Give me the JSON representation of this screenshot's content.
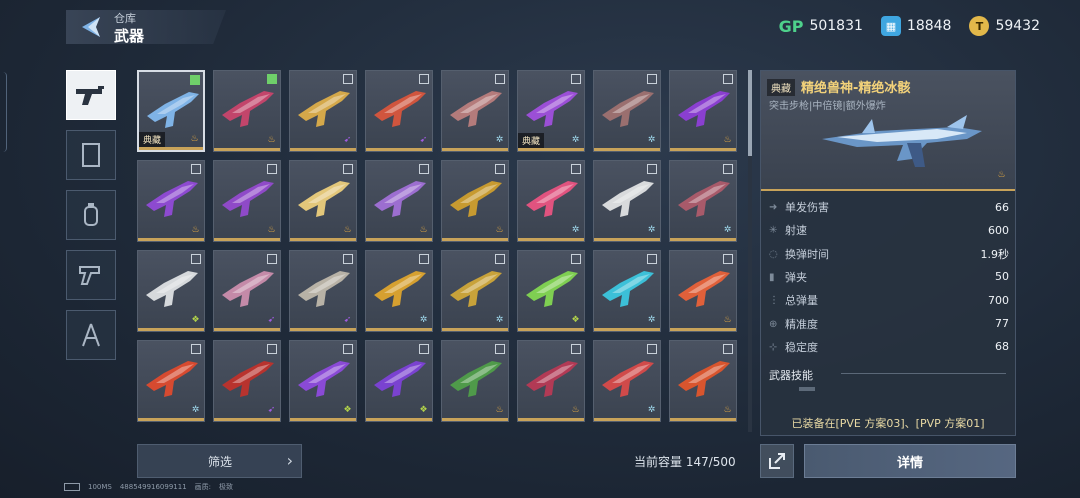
{
  "header": {
    "parent": "仓库",
    "title": "武器"
  },
  "currencies": [
    {
      "icon": "gp-icon",
      "symbol": "GP",
      "value": "501831"
    },
    {
      "icon": "ticket-icon",
      "symbol": "▦",
      "value": "18848"
    },
    {
      "icon": "coin-icon",
      "symbol": "T",
      "value": "59432"
    }
  ],
  "categories": [
    "weapon-category",
    "armor-category",
    "grenade-category",
    "melee-category",
    "tool-category"
  ],
  "items": [
    {
      "tag": "典藏",
      "badge": "fire",
      "checked": true,
      "color": "#7fb3e6"
    },
    {
      "tag": "",
      "badge": "fire",
      "checked": true,
      "color": "#c2456b"
    },
    {
      "tag": "",
      "badge": "arrow",
      "checked": false,
      "color": "#d4a84a"
    },
    {
      "tag": "",
      "badge": "arrow",
      "checked": false,
      "color": "#d0553e"
    },
    {
      "tag": "",
      "badge": "star",
      "checked": false,
      "color": "#b47b7b"
    },
    {
      "tag": "典藏",
      "badge": "star",
      "checked": false,
      "color": "#9b4fd6"
    },
    {
      "tag": "",
      "badge": "star",
      "checked": false,
      "color": "#9a6f6f"
    },
    {
      "tag": "",
      "badge": "fire",
      "checked": false,
      "color": "#8a3fd0"
    },
    {
      "tag": "",
      "badge": "fire",
      "checked": false,
      "color": "#8d4ad0"
    },
    {
      "tag": "",
      "badge": "fire",
      "checked": false,
      "color": "#8f4ac8"
    },
    {
      "tag": "",
      "badge": "fire",
      "checked": false,
      "color": "#e3c77a"
    },
    {
      "tag": "",
      "badge": "fire",
      "checked": false,
      "color": "#9c6ed0"
    },
    {
      "tag": "",
      "badge": "fire",
      "checked": false,
      "color": "#c79a30"
    },
    {
      "tag": "",
      "badge": "star",
      "checked": false,
      "color": "#e0537f"
    },
    {
      "tag": "",
      "badge": "star",
      "checked": false,
      "color": "#d8dadc"
    },
    {
      "tag": "",
      "badge": "star",
      "checked": false,
      "color": "#a85a6a"
    },
    {
      "tag": "",
      "badge": "green",
      "checked": false,
      "color": "#d6d9dc"
    },
    {
      "tag": "",
      "badge": "arrow",
      "checked": false,
      "color": "#c48aa8"
    },
    {
      "tag": "",
      "badge": "arrow",
      "checked": false,
      "color": "#b8b2a6"
    },
    {
      "tag": "",
      "badge": "star",
      "checked": false,
      "color": "#d6a030"
    },
    {
      "tag": "",
      "badge": "star",
      "checked": false,
      "color": "#c8a23a"
    },
    {
      "tag": "",
      "badge": "green",
      "checked": false,
      "color": "#7fcf52"
    },
    {
      "tag": "",
      "badge": "star",
      "checked": false,
      "color": "#3cc0d8"
    },
    {
      "tag": "",
      "badge": "fire",
      "checked": false,
      "color": "#e0603a"
    },
    {
      "tag": "",
      "badge": "star",
      "checked": false,
      "color": "#d64a30"
    },
    {
      "tag": "",
      "badge": "arrow",
      "checked": false,
      "color": "#b8332e"
    },
    {
      "tag": "",
      "badge": "green",
      "checked": false,
      "color": "#8a4ad6"
    },
    {
      "tag": "",
      "badge": "green",
      "checked": false,
      "color": "#7a42d0"
    },
    {
      "tag": "",
      "badge": "fire",
      "checked": false,
      "color": "#4f9a4a"
    },
    {
      "tag": "",
      "badge": "fire",
      "checked": false,
      "color": "#b23a55"
    },
    {
      "tag": "",
      "badge": "star",
      "checked": false,
      "color": "#d04a4a"
    },
    {
      "tag": "",
      "badge": "fire",
      "checked": false,
      "color": "#d8552e"
    }
  ],
  "detail": {
    "tag": "典藏",
    "name": "精绝兽神-精绝冰骸",
    "subtitle": "突击步枪|中倍镜|额外爆炸",
    "stats": [
      {
        "label": "单发伤害",
        "value": "66"
      },
      {
        "label": "射速",
        "value": "600"
      },
      {
        "label": "换弹时间",
        "value": "1.9秒"
      },
      {
        "label": "弹夹",
        "value": "50"
      },
      {
        "label": "总弹量",
        "value": "700"
      },
      {
        "label": "精准度",
        "value": "77"
      },
      {
        "label": "稳定度",
        "value": "68"
      }
    ],
    "skill_header": "武器技能",
    "equipped": "已装备在[PVE 方案03]、[PVP 方案01]"
  },
  "filter_label": "筛选",
  "capacity": "当前容量 147/500",
  "detail_button": "详情",
  "footer": {
    "ping": "100MS",
    "id": "488549916099111",
    "quality_label": "画质:",
    "quality": "极致"
  }
}
